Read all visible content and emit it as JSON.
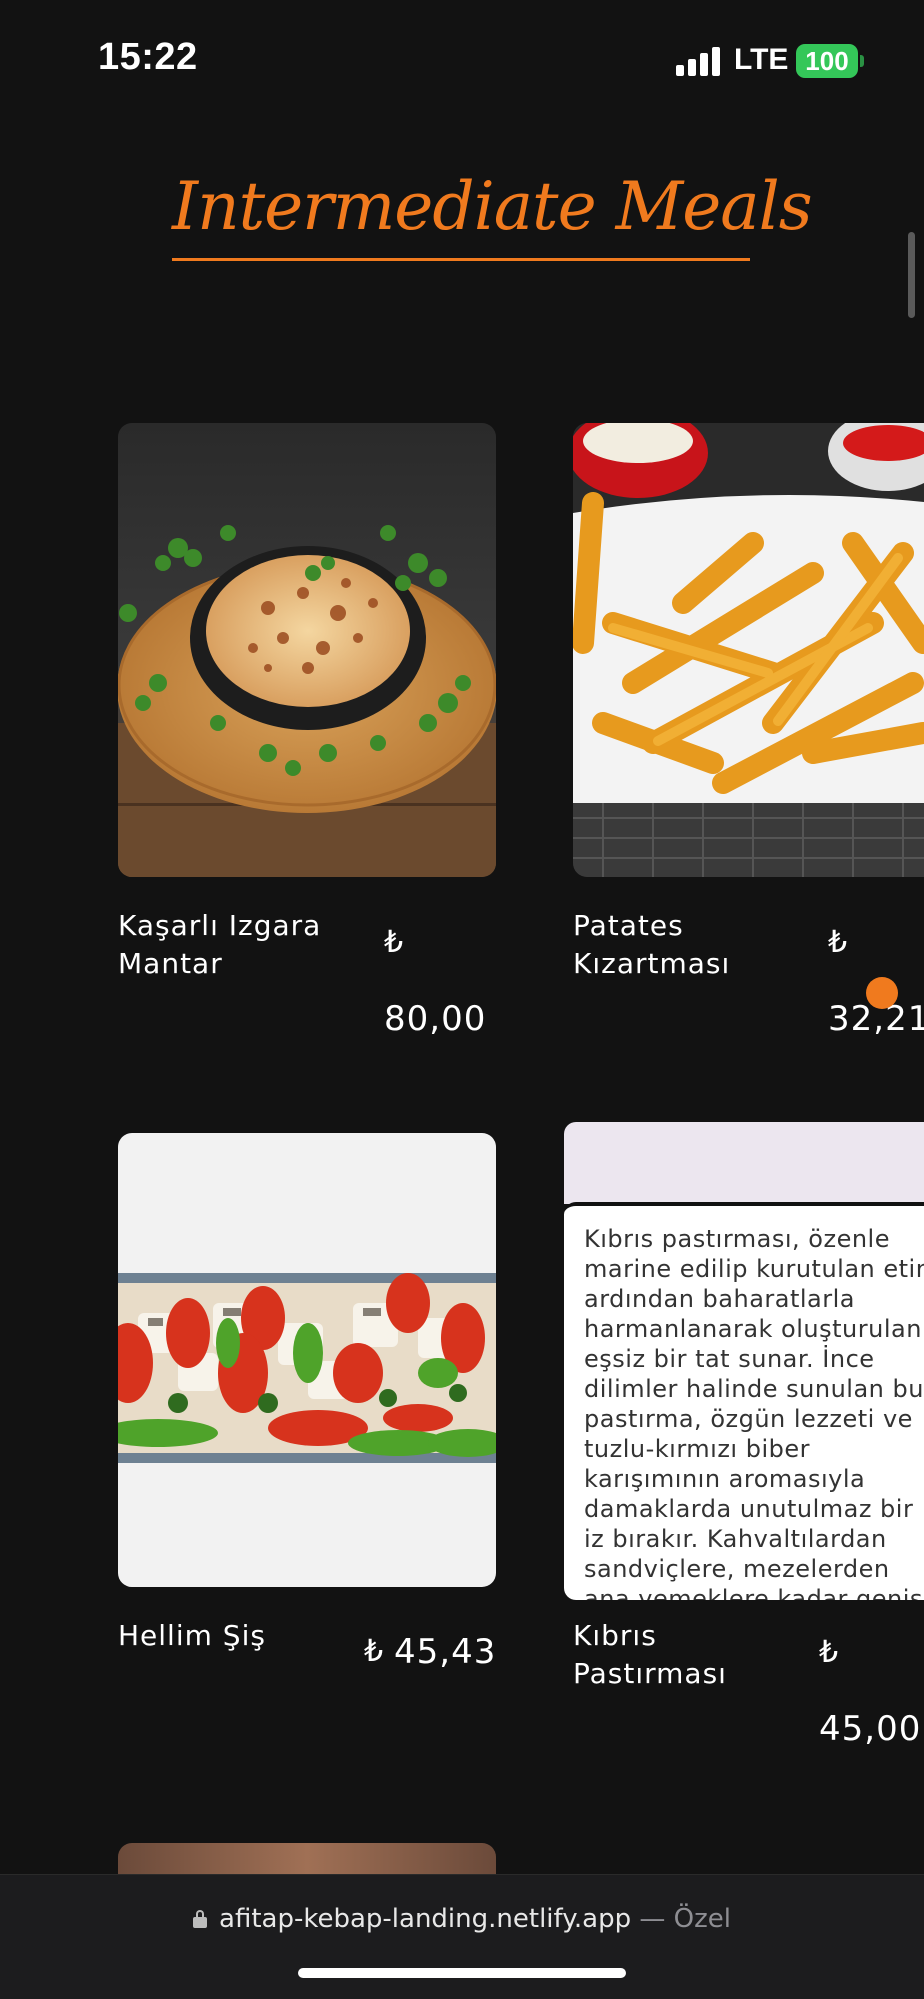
{
  "status_bar": {
    "time": "15:22",
    "network": "LTE",
    "battery": "100"
  },
  "section": {
    "title": "Intermediate Meals",
    "accent_color": "#f07a1e"
  },
  "menu_items": [
    {
      "name_line1": "Kaşarlı Izgara",
      "name_line2": "Mantar",
      "currency": "₺",
      "price": "80,00",
      "image": "mushroom-skillet-image"
    },
    {
      "name_line1": "Patates",
      "name_line2": "Kızartması",
      "currency": "₺",
      "price": "32,21",
      "image": "french-fries-image"
    },
    {
      "name_line1": "Hellim Şiş",
      "currency": "₺",
      "price": "45,43",
      "image": "halloumi-skewer-image"
    },
    {
      "name_line1": "Kıbrıs",
      "name_line2": "Pastırması",
      "currency": "₺",
      "price": "45,00",
      "description": "Kıbrıs pastırması, özenle marine edilip kurutulan etin ardından baharatlarla harmanlanarak oluşturulan eşsiz bir tat sunar. İnce dilimler halinde sunulan bu pastırma, özgün lezzeti ve tuzlu-kırmızı biber karışımının aromasıyla damaklarda unutulmaz bir iz bırakır. Kahvaltılardan sandviçlere, mezelerden ana yemeklere kadar geniş bir"
    }
  ],
  "browser": {
    "url": "afitap-kebap-landing.netlify.app",
    "separator": " — ",
    "mode": "Özel"
  }
}
